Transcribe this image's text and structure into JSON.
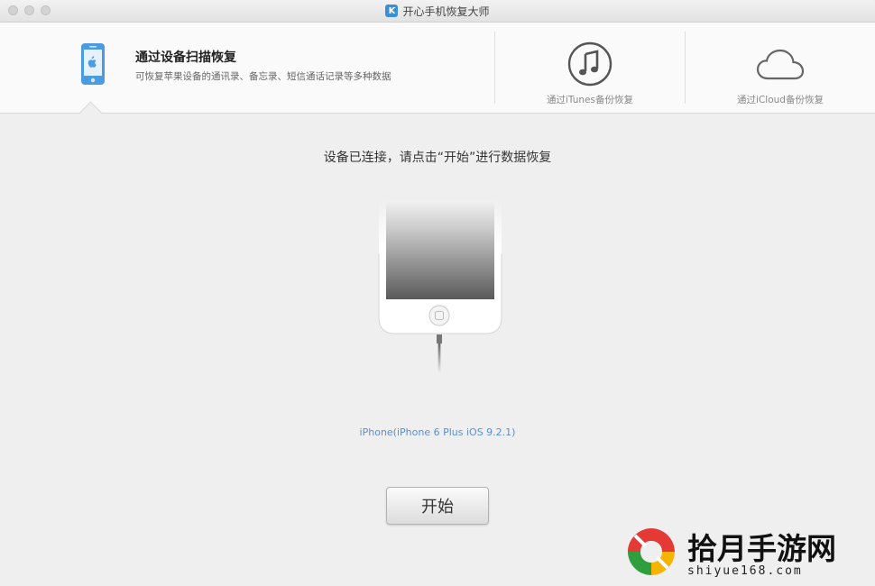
{
  "window": {
    "title": "开心手机恢复大师",
    "app_icon_letter": "K"
  },
  "modes": {
    "device": {
      "title": "通过设备扫描恢复",
      "description": "可恢复苹果设备的通讯录、备忘录、短信通话记录等多种数据",
      "icon": "iphone-icon",
      "selected": true
    },
    "itunes": {
      "label": "通过iTunes备份恢复",
      "icon": "music-note-icon"
    },
    "icloud": {
      "label": "通过iCloud备份恢复",
      "icon": "cloud-icon"
    }
  },
  "main": {
    "status": "设备已连接，请点击“开始”进行数据恢复",
    "device_name": "iPhone(iPhone 6 Plus iOS 9.2.1)",
    "start_label": "开始"
  },
  "watermark": {
    "title": "拾月手游网",
    "subtitle": "shiyue168.com"
  },
  "colors": {
    "accent_blue": "#3b8fd6",
    "device_link": "#5a8fd0",
    "background": "#efefef"
  }
}
